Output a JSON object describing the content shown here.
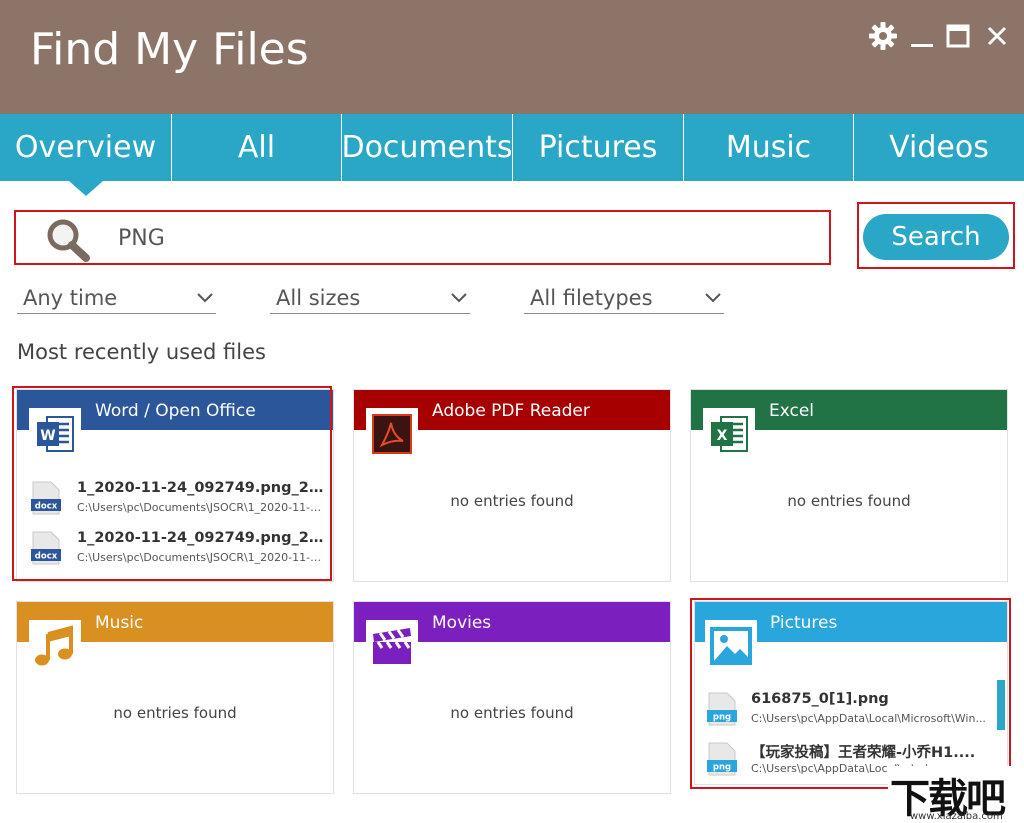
{
  "app": {
    "title": "Find My Files"
  },
  "window_controls": [
    "gear-icon",
    "minimize-icon",
    "maximize-icon",
    "close-icon"
  ],
  "tabs": [
    {
      "label": "Overview",
      "active": true
    },
    {
      "label": "All"
    },
    {
      "label": "Documents"
    },
    {
      "label": "Pictures"
    },
    {
      "label": "Music"
    },
    {
      "label": "Videos"
    }
  ],
  "search": {
    "value": "PNG",
    "button_label": "Search"
  },
  "filters": [
    {
      "selected": "Any time"
    },
    {
      "selected": "All sizes"
    },
    {
      "selected": "All filetypes"
    }
  ],
  "section_title": "Most recently used files",
  "cards": [
    {
      "label": "Word / Open Office",
      "color": "#2b579a",
      "icon": "word-icon",
      "files": [
        {
          "name": "1_2020-11-24_092749.png_2020...",
          "path": "C:\\Users\\pc\\Documents\\JSOCR\\1_2020-11-24_...",
          "icon": "docx-file-icon",
          "icon_label": "docx"
        },
        {
          "name": "1_2020-11-24_092749.png_2020...",
          "path": "C:\\Users\\pc\\Documents\\JSOCR\\1_2020-11-24_...",
          "icon": "docx-file-icon",
          "icon_label": "docx"
        }
      ]
    },
    {
      "label": "Adobe PDF Reader",
      "color": "#a60000",
      "icon": "pdf-icon",
      "empty": "no entries found"
    },
    {
      "label": "Excel",
      "color": "#217346",
      "icon": "excel-icon",
      "empty": "no entries found"
    },
    {
      "label": "Music",
      "color": "#d99020",
      "icon": "music-note-icon",
      "empty": "no entries found"
    },
    {
      "label": "Movies",
      "color": "#7b1fbe",
      "icon": "clapperboard-icon",
      "empty": "no entries found"
    },
    {
      "label": "Pictures",
      "color": "#29a6dc",
      "icon": "picture-icon",
      "files": [
        {
          "name": "616875_0[1].png",
          "path": "C:\\Users\\pc\\AppData\\Local\\Microsoft\\Win...",
          "icon": "png-file-icon",
          "icon_label": "png"
        },
        {
          "name": "【玩家投稿】王者荣耀-小乔H1....",
          "path": "C:\\Users\\pc\\AppData\\Local\\...\\...\\...",
          "icon": "png-file-icon",
          "icon_label": "png"
        }
      ]
    }
  ],
  "watermark": {
    "logo_text": "下载吧",
    "url": "www.xiazaiba.com"
  }
}
